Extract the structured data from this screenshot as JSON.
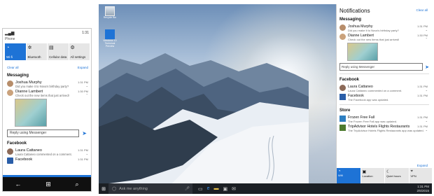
{
  "phone": {
    "carrier": "Phone",
    "time": "1:31",
    "tiles": [
      {
        "label": "Wi-fi",
        "icon": "wifi-icon",
        "glyph": "◔",
        "on": true
      },
      {
        "label": "Bluetooth",
        "icon": "bluetooth-icon",
        "glyph": "✲",
        "on": false
      },
      {
        "label": "Cellular data",
        "icon": "cellular-icon",
        "glyph": "▤",
        "on": false
      },
      {
        "label": "All settings",
        "icon": "gear-icon",
        "glyph": "⚙",
        "on": false
      }
    ],
    "clear_all": "Clear all",
    "expand": "Expand",
    "messaging_header": "Messaging",
    "notifications": [
      {
        "name": "Joshua Murphy",
        "message": "Did you make it to Nova's birthday party?",
        "time": "1:31 PM"
      },
      {
        "name": "Dianne Lambert",
        "message": "Check out the new items that just arrived!",
        "time": "1:30 PM"
      }
    ],
    "reply_placeholder": "Reply using Messenger",
    "facebook_header": "Facebook",
    "facebook_notifications": [
      {
        "name": "Laura Cattaneo",
        "message": "Laura Cattaneo commented on a comment.",
        "time": "1:31 PM"
      },
      {
        "name": "Facebook",
        "message": "",
        "time": "1:31 PM"
      }
    ]
  },
  "desktop": {
    "icons": [
      {
        "label": "Recycle Bin",
        "icon": "recycle-bin-icon"
      },
      {
        "label": "Windows 10 Technical Preview",
        "icon": "windows-icon"
      }
    ],
    "search_placeholder": "Ask me anything",
    "clock_time": "1:31 PM",
    "clock_date": "2/6/2015"
  },
  "action_center": {
    "title": "Notifications",
    "clear_all": "Clear all",
    "messaging_header": "Messaging",
    "messaging": [
      {
        "name": "Joshua Murphy",
        "message": "Did you make it to Nova's birthday party?",
        "time": "1:31 PM"
      },
      {
        "name": "Dianne Lambert",
        "message": "Check out the new items that just arrived!",
        "time": "1:30 PM"
      }
    ],
    "reply_placeholder": "Reply using Messenger",
    "facebook_header": "Facebook",
    "facebook": [
      {
        "name": "Laura Cattaneo",
        "message": "Laura Cattaneo commented on a comment.",
        "time": "1:31 PM"
      },
      {
        "name": "Facebook",
        "message": "The Facebook app was updated.",
        "time": "1:31 PM"
      }
    ],
    "store_header": "Store",
    "store": [
      {
        "name": "Frozen Free Fall",
        "message": "The Frozen Free Fall app was updated.",
        "time": "1:31 PM"
      },
      {
        "name": "TripAdvisor Hotels Flights Restaurants",
        "message": "The TripAdvisor Hotels Flights Restaurants app was updated.",
        "time": "1:31 PM"
      }
    ],
    "expand": "Expand",
    "tiles": [
      {
        "label": "Wifi",
        "glyph": "◔",
        "on": true
      },
      {
        "label": "Location",
        "glyph": "▣",
        "on": false
      },
      {
        "label": "Quiet hours",
        "glyph": "☾",
        "on": false
      },
      {
        "label": "VPN",
        "glyph": "⌖",
        "on": false
      }
    ]
  },
  "colors": {
    "accent": "#1e73d6",
    "taskbar": "#1b1f24"
  }
}
